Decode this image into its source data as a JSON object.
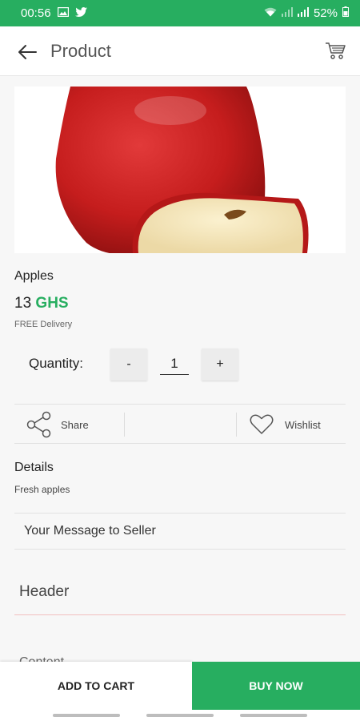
{
  "status_bar": {
    "time": "00:56",
    "battery": "52%"
  },
  "app_bar": {
    "title": "Product",
    "back_icon": "arrow-left-icon",
    "cart_icon": "cart-icon"
  },
  "product": {
    "name": "Apples",
    "price_amount": "13",
    "price_currency": "GHS",
    "delivery": "FREE Delivery",
    "image_subject": "red apple with slice"
  },
  "quantity": {
    "label": "Quantity:",
    "minus": "-",
    "value": "1",
    "plus": "+"
  },
  "actions": {
    "share": "Share",
    "wishlist": "Wishlist"
  },
  "details": {
    "title": "Details",
    "text": "Fresh apples"
  },
  "message": {
    "label": "Your Message to Seller"
  },
  "header_field": {
    "label": "Header"
  },
  "content_field": {
    "label": "Content"
  },
  "bottom_bar": {
    "add_to_cart": "ADD TO CART",
    "buy_now": "BUY NOW"
  },
  "colors": {
    "accent": "#27ae60",
    "apple_red": "#c81e1e"
  }
}
